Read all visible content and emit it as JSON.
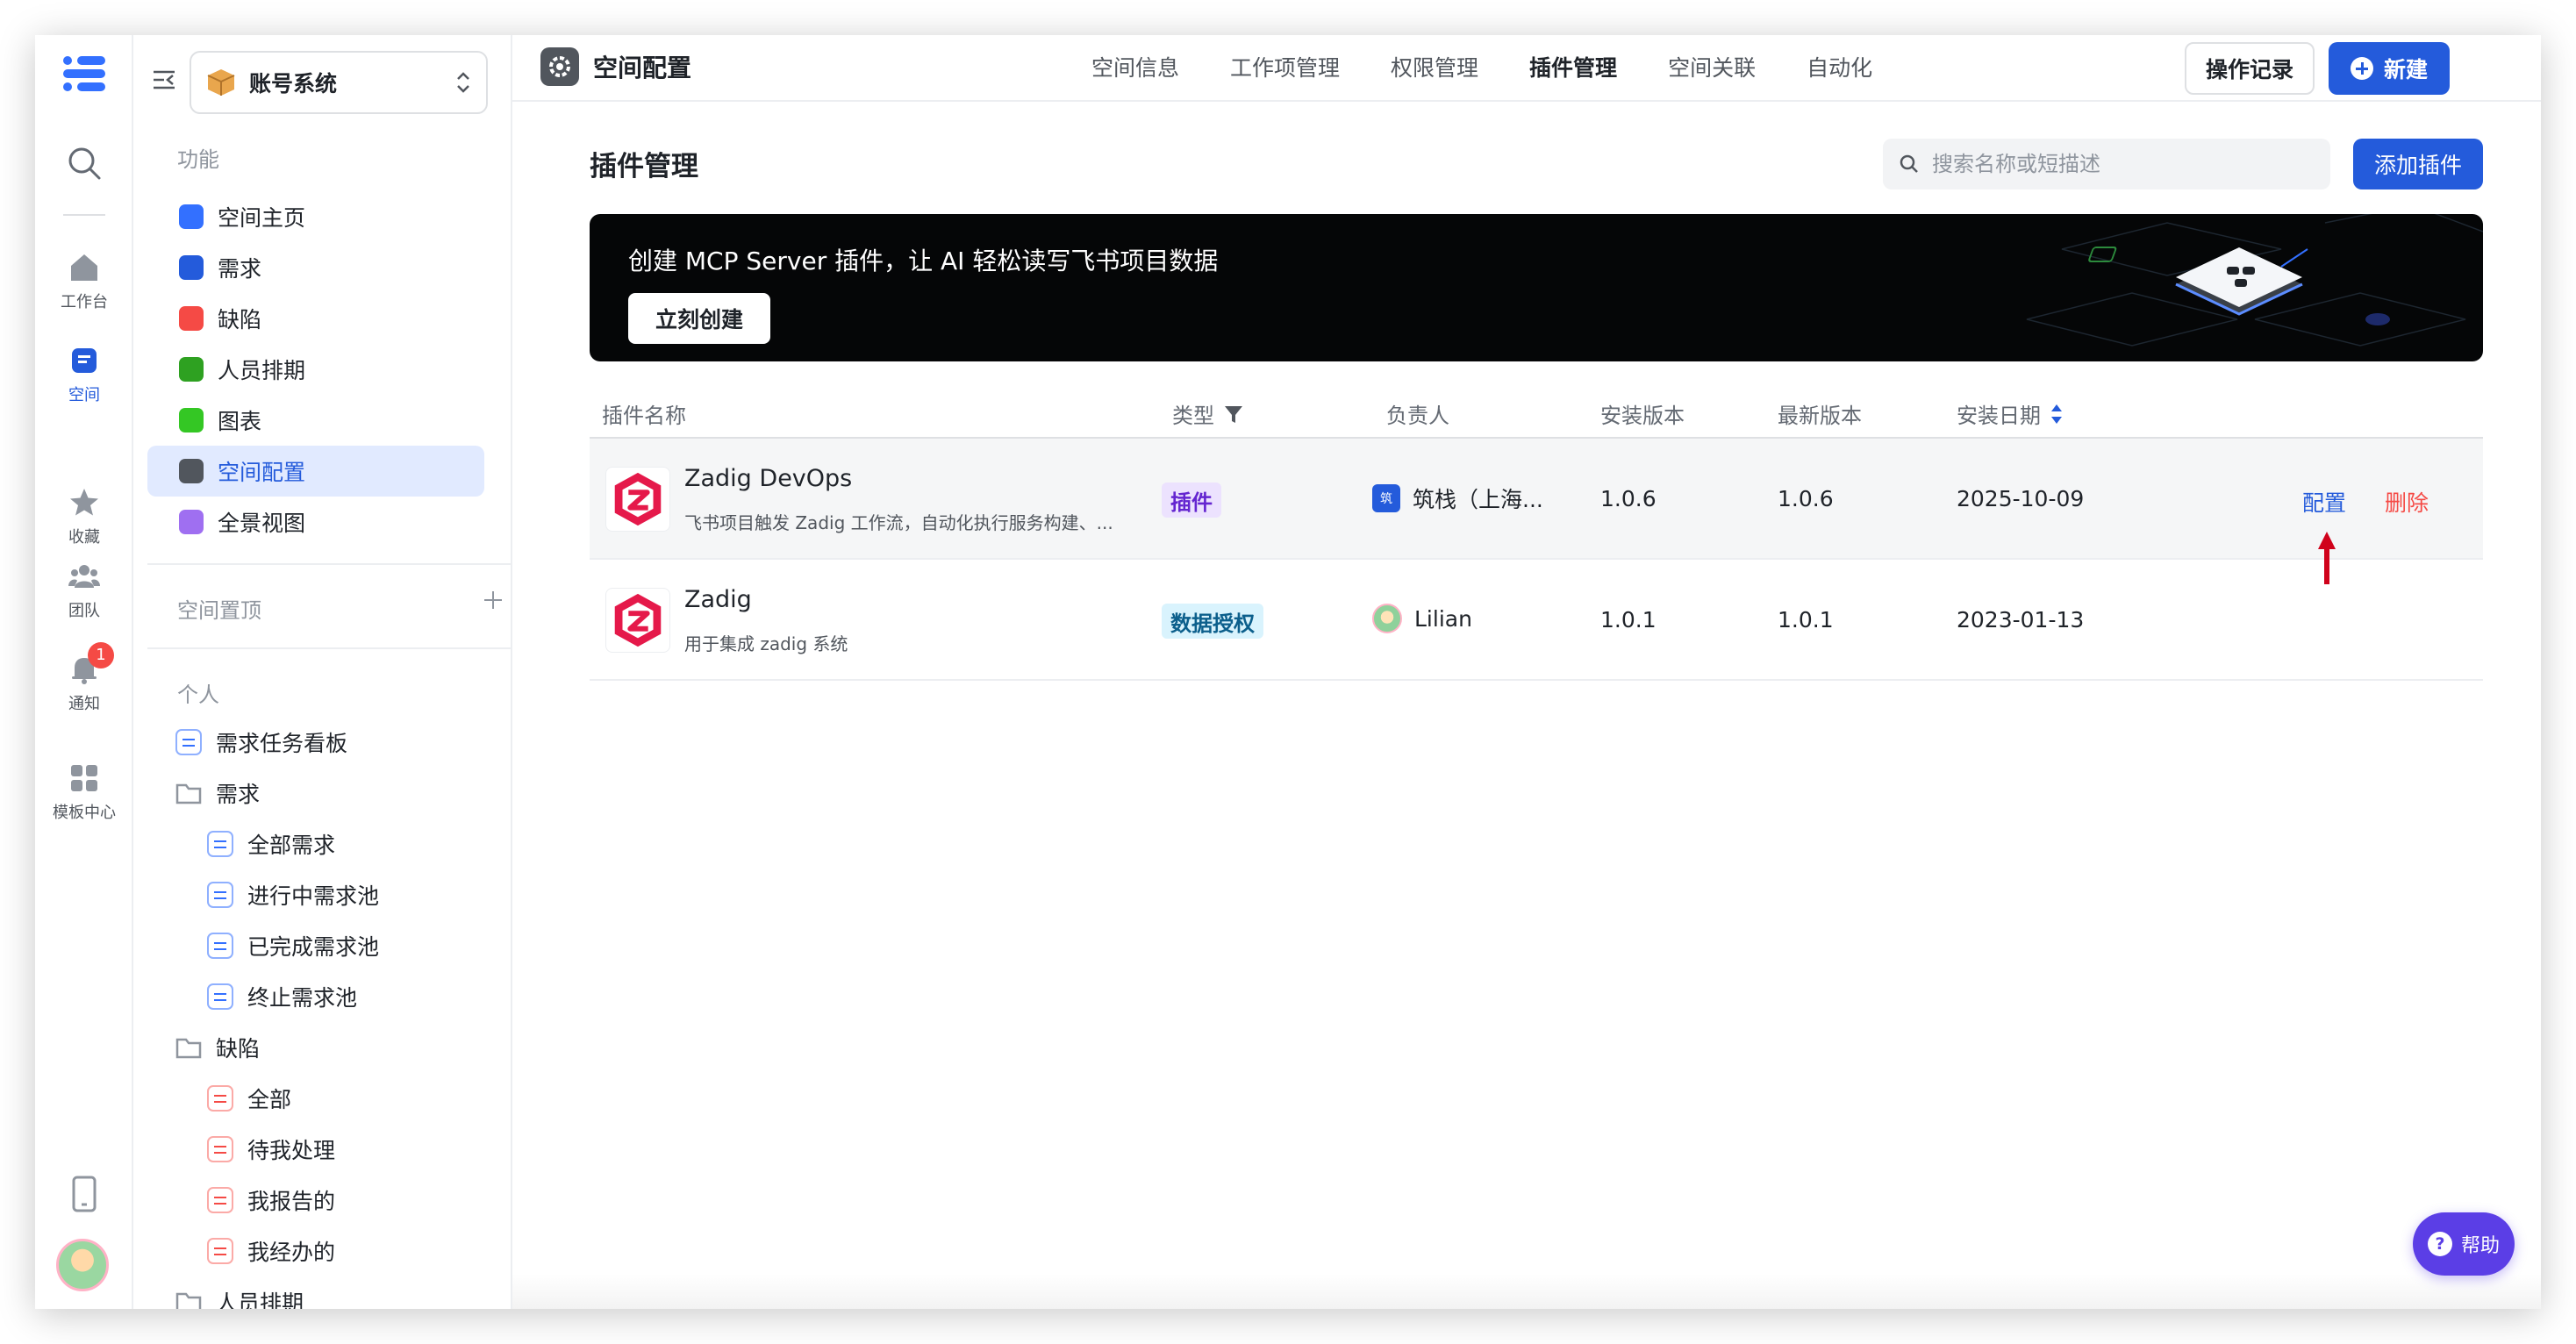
{
  "rail": {
    "items": [
      {
        "label": "工作台",
        "icon": "home-icon"
      },
      {
        "label": "空间",
        "icon": "space-icon",
        "active": true
      },
      {
        "label": "收藏",
        "icon": "star-icon"
      },
      {
        "label": "团队",
        "icon": "team-icon"
      },
      {
        "label": "通知",
        "icon": "bell-icon",
        "badge": "1"
      },
      {
        "label": "模板中心",
        "icon": "template-icon"
      }
    ]
  },
  "sidebar": {
    "space_name": "账号系统",
    "section_features": "功能",
    "features": [
      {
        "label": "空间主页",
        "color": "#3370ff"
      },
      {
        "label": "需求",
        "color": "#245bdb"
      },
      {
        "label": "缺陷",
        "color": "#f54a45"
      },
      {
        "label": "人员排期",
        "color": "#2ea121"
      },
      {
        "label": "图表",
        "color": "#34c724"
      },
      {
        "label": "空间配置",
        "color": "#51565d"
      },
      {
        "label": "全景视图",
        "color": "#9f6ff1"
      }
    ],
    "section_pinned": "空间置顶",
    "section_personal": "个人",
    "tree": [
      {
        "label": "需求任务看板"
      },
      {
        "label": "需求"
      },
      {
        "label": "全部需求"
      },
      {
        "label": "进行中需求池"
      },
      {
        "label": "已完成需求池"
      },
      {
        "label": "终止需求池"
      },
      {
        "label": "缺陷"
      },
      {
        "label": "全部"
      },
      {
        "label": "待我处理"
      },
      {
        "label": "我报告的"
      },
      {
        "label": "我经办的"
      },
      {
        "label": "人员排期"
      }
    ]
  },
  "topbar": {
    "title": "空间配置",
    "tabs": [
      "空间信息",
      "工作项管理",
      "权限管理",
      "插件管理",
      "空间关联",
      "自动化"
    ],
    "active_tab": "插件管理",
    "log_button": "操作记录",
    "new_button": "新建"
  },
  "main": {
    "title": "插件管理",
    "search_placeholder": "搜索名称或短描述",
    "add_button": "添加插件",
    "banner": {
      "text": "创建 MCP Server 插件，让 AI 轻松读写飞书项目数据",
      "button": "立刻创建"
    },
    "columns": [
      "插件名称",
      "类型",
      "负责人",
      "安装版本",
      "最新版本",
      "安装日期"
    ],
    "rows": [
      {
        "name": "Zadig DevOps",
        "desc": "飞书项目触发 Zadig 工作流，自动化执行服务构建、...",
        "type": "插件",
        "owner": "筑栈（上海...",
        "owner_icon_text": "筑",
        "installed": "1.0.6",
        "latest": "1.0.6",
        "date": "2025-10-09",
        "actions": [
          "配置",
          "删除"
        ]
      },
      {
        "name": "Zadig",
        "desc": "用于集成 zadig 系统",
        "type": "数据授权",
        "owner": "Lilian",
        "installed": "1.0.1",
        "latest": "1.0.1",
        "date": "2023-01-13"
      }
    ]
  },
  "help": {
    "label": "帮助"
  }
}
